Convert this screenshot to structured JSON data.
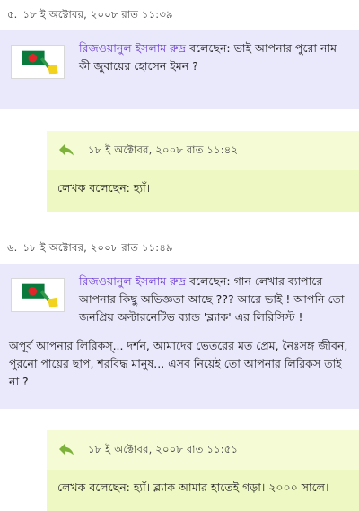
{
  "comments": [
    {
      "number": "৫.",
      "timestamp": "১৮ ই অক্টোবর, ২০০৮ রাত ১১:৩৯",
      "author": "রিজওয়ানুল ইসলাম রুদ্র",
      "text": " বলেছেন: ভাই আপনার পুরো নাম কী জুবায়ের হোসেন ইমন ?",
      "reply": {
        "timestamp": "১৮ ই অক্টোবর, ২০০৮ রাত ১১:৪২",
        "text": "লেখক বলেছেন: হ্যাঁ।"
      }
    },
    {
      "number": "৬.",
      "timestamp": "১৮ ই অক্টোবর, ২০০৮ রাত ১১:৪৯",
      "author": "রিজওয়ানুল ইসলাম রুদ্র",
      "text": " বলেছেন: গান লেখার ব্যাপারে আপনার কিছু অভিজ্ঞতা আছে ??? আরে ভাই ! আপনি তো জনপ্রিয় অল্টারনেটিভ ব্যান্ড 'ব্ল্যাক' এর লিরিসিস্ট !",
      "paragraph": "অপূর্ব আপনার লিরিকস্... দর্শন, আমাদের ভেতরের মত প্রেম, নৈঃসঙ্গ জীবন, পুরনো পায়ের ছাপ, শরবিদ্ধ মানুষ... এসব নিয়েই তো আপনার লিরিকস তাই না ?",
      "reply": {
        "timestamp": "১৮ ই অক্টোবর, ২০০৮ রাত ১১:৫১",
        "text": "লেখক বলেছেন: হ্যাঁ। ব্ল্যাক আমার হাতেই গড়া। ২০০০ সালে।"
      }
    }
  ],
  "icons": {
    "avatar": "flag-avatar-icon",
    "reply": "reply-arrow-icon"
  },
  "colors": {
    "comment_bg": "#eae8fb",
    "reply_bg": "#eef8c2",
    "author": "#6a3bd0"
  }
}
